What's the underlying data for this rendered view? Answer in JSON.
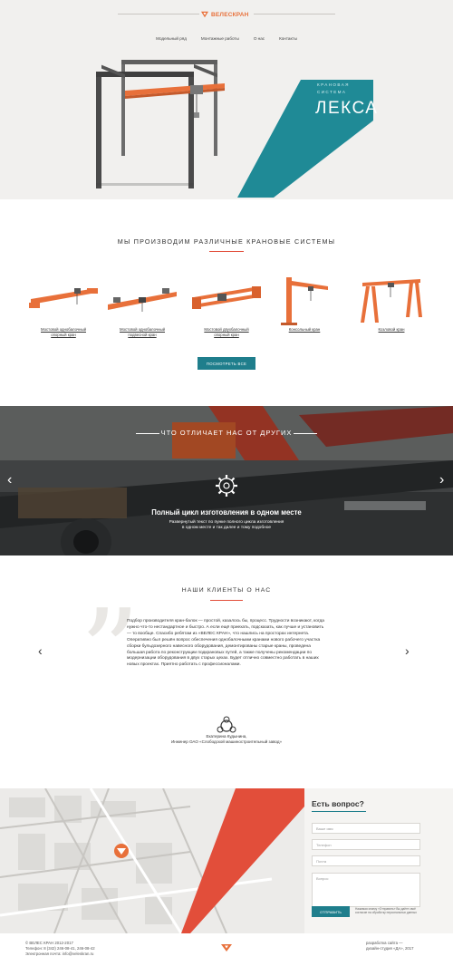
{
  "header": {
    "logo_text": "ВЕЛЕСКРАН",
    "nav": [
      "Модельный ряд",
      "Монтажные работы",
      "О нас",
      "Контакты"
    ]
  },
  "hero": {
    "subtitle_line1": "КРАНОВАЯ",
    "subtitle_line2": "СИСТЕМА",
    "title": "ЛЕКСА",
    "accent_color": "#1f8a96"
  },
  "products": {
    "title": "МЫ ПРОИЗВОДИМ РАЗЛИЧНЫЕ КРАНОВЫЕ СИСТЕМЫ",
    "items": [
      {
        "line1": "Мостовой однобалочный",
        "line2": "опорный кран"
      },
      {
        "line1": "Мостовой однобалочный",
        "line2": "подвесной кран"
      },
      {
        "line1": "Мостовой двухбалочный",
        "line2": "опорный кран"
      },
      {
        "line1": "Консольный кран",
        "line2": ""
      },
      {
        "line1": "Козловой кран",
        "line2": ""
      }
    ],
    "button": "ПОСМОТРЕТЬ ВСЕ",
    "brand_color": "#e8703a"
  },
  "features": {
    "title": "ЧТО ОТЛИЧАЕТ НАС ОТ ДРУГИХ",
    "heading": "Полный цикл изготовления в одном месте",
    "text_line1": "Развернутый текст по пунке полного цикла изготовления",
    "text_line2": "в одном месте и так далее и тому подобное",
    "prev_arrow": "‹",
    "next_arrow": "›"
  },
  "reviews": {
    "title": "НАШИ КЛИЕНТЫ О НАС",
    "text": "Подбор производителя кран-балок — простой, казалось бы, процесс. Трудности возникают, когда нужно что-то нестандартное и быстро. А если ещё приехать, подсказать, как лучше и установить — то вообще. Спасибо ребятам из «ВЕЛЕС КРАН», что нашлись на просторах интернета. Оперативно был решён вопрос обеспечения однобалочными кранами нового рабочего участка сборки бульдозерного навесного оборудования, демонтированы старые краны, проведена большая работа по реконструкции подкрановых путей, а также получены рекомендации по модернизации оборудования в двух старых цехах. Будет отлично совместно работать в наших новых проектах. Приятно работать с профессионалами.",
    "name": "Екатерина Кудынина,",
    "position": "Инженер ОАО «Слободской машиностроительный завод»",
    "prev_arrow": "‹",
    "next_arrow": "›"
  },
  "contact": {
    "title": "Есть вопрос?",
    "name_placeholder": "Ваше имя",
    "phone_placeholder": "Телефон",
    "email_placeholder": "Почта",
    "message_placeholder": "Вопрос",
    "send_button": "ОТПРАВИТЬ",
    "consent": "Нажимая кнопку «Отправить» Вы даёте своё согласие на обработку персональных данных"
  },
  "footer": {
    "copyright": "© ВЕЛЕС КРАН 2012-2017",
    "phone": "Телефон: 8 (342) 246-08-41, 246-08-42",
    "email": "Электронная почта: info@veleskran.ru",
    "dev_link": "разработка сайта —",
    "dev_studio": "дизайн-студия «ДА», 2017"
  }
}
